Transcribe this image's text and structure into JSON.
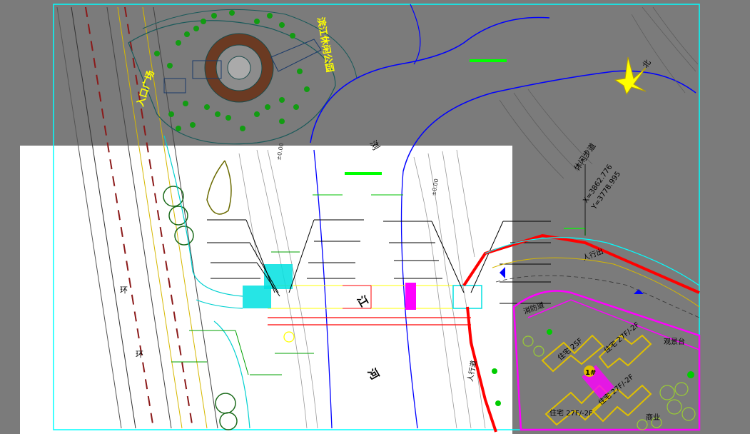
{
  "drawing": {
    "labels": {
      "entrance_plaza": "入口广场",
      "riverside_park": "滨江休闲公园",
      "river_char_1": "浏",
      "river_char_2": "江",
      "river_char_3": "河",
      "ring_road_1": "环",
      "ring_road_2": "环",
      "leisure_path": "休闲步道",
      "north": "北",
      "building_a": "住宅 27F/-2F",
      "building_b": "住宅 27F/-2F",
      "building_c": "住宅 25F",
      "building_d": "住宅 27F/-2F",
      "commercial": "商业",
      "entrance_north": "人行出",
      "entrance_south": "人行道",
      "coord_x": "X=3862.776",
      "coord_y": "Y=3778.995",
      "pavilion": "观景台",
      "fire_lane": "消防道",
      "elevation_1": "±0.00",
      "elevation_2": "±0.00",
      "unit_label": "1#"
    },
    "colors": {
      "background_dark": "#7b7b7b",
      "background_paper": "#ffffff",
      "border": "#00ffff",
      "river": "#0000ff",
      "road_yellow": "#ffff00",
      "building": "#ff00ff",
      "red_line": "#ff0000",
      "tree": "#00cc00",
      "highlight_green": "#00ff00",
      "label_yellow": "#ffff00"
    }
  }
}
